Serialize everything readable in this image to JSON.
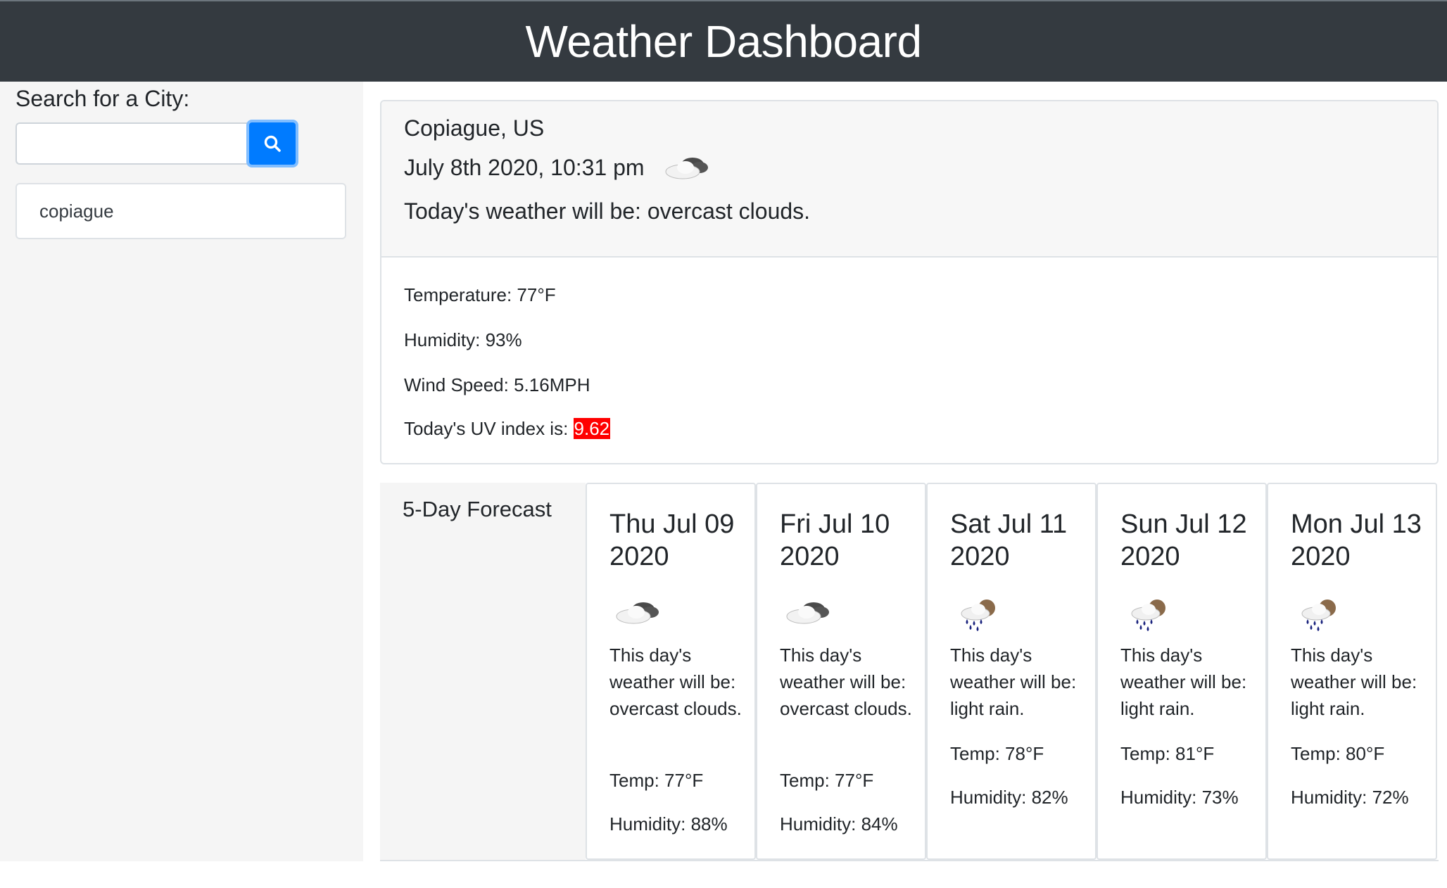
{
  "header": {
    "title": "Weather Dashboard"
  },
  "search": {
    "label": "Search for a City:",
    "value": "",
    "placeholder": ""
  },
  "history": [
    "copiague"
  ],
  "current": {
    "city": "Copiague, US",
    "datetime": "July 8th 2020, 10:31 pm",
    "icon": "overcast-clouds-icon",
    "description": "Today's weather will be: overcast clouds.",
    "temperature": "Temperature: 77°F",
    "humidity": "Humidity: 93%",
    "wind": "Wind Speed: 5.16MPH",
    "uv_label": "Today's UV index is: ",
    "uv_value": "9.62",
    "uv_color": "#ff0000"
  },
  "forecast": {
    "label": "5-Day Forecast",
    "days": [
      {
        "date": "Thu Jul 09 2020",
        "icon": "overcast-clouds-icon",
        "description": "This day's weather will be: overcast clouds.",
        "temp": "Temp: 77°F",
        "humidity": "Humidity: 88%"
      },
      {
        "date": "Fri Jul 10 2020",
        "icon": "overcast-clouds-icon",
        "description": "This day's weather will be: overcast clouds.",
        "temp": "Temp: 77°F",
        "humidity": "Humidity: 84%"
      },
      {
        "date": "Sat Jul 11 2020",
        "icon": "light-rain-icon",
        "description": "This day's weather will be: light rain.",
        "temp": "Temp: 78°F",
        "humidity": "Humidity: 82%"
      },
      {
        "date": "Sun Jul 12 2020",
        "icon": "light-rain-icon",
        "description": "This day's weather will be: light rain.",
        "temp": "Temp: 81°F",
        "humidity": "Humidity: 73%"
      },
      {
        "date": "Mon Jul 13 2020",
        "icon": "light-rain-icon",
        "description": "This day's weather will be: light rain.",
        "temp": "Temp: 80°F",
        "humidity": "Humidity: 72%"
      }
    ]
  },
  "colors": {
    "navbar": "#343a40",
    "primary": "#007bff",
    "uv_high": "#ff0000"
  }
}
